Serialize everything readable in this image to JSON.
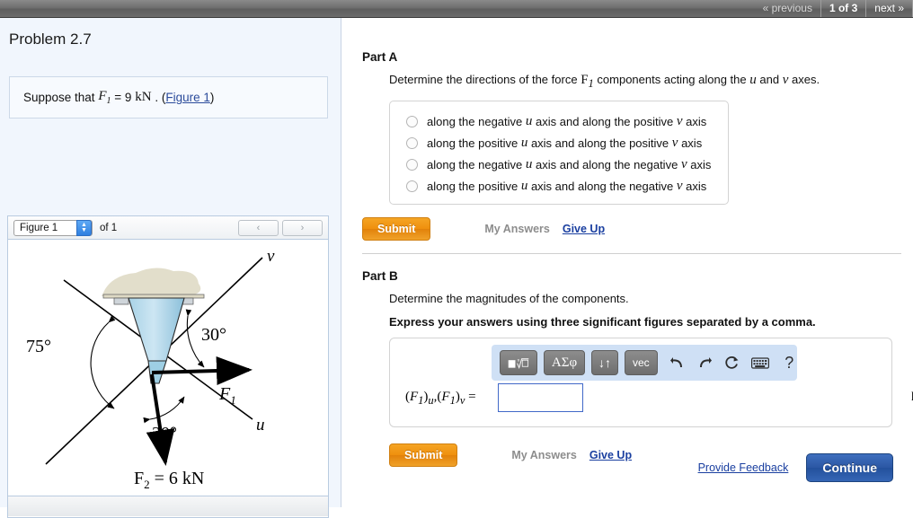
{
  "topnav": {
    "previous": "« previous",
    "counter": "1 of 3",
    "next": "next »"
  },
  "problem": {
    "title": "Problem 2.7",
    "statement_prefix": "Suppose that",
    "statement_var": "F",
    "statement_sub": "1",
    "statement_eq": "= 9",
    "statement_unit": "kN",
    "statement_dot": ".",
    "figure_link": "Figure 1",
    "paren_open": "(",
    "paren_close": ")"
  },
  "figure_widget": {
    "select_value": "Figure 1",
    "of_label": "of 1",
    "prev_arrow": "‹",
    "next_arrow": "›"
  },
  "figure": {
    "axis_v_label": "v",
    "axis_u_label": "u",
    "force1_label": "F",
    "force1_sub": "1",
    "force2_label": "F",
    "force2_sub": "2",
    "force2_value": "= 6 kN",
    "angle_75": "75°",
    "angle_30_upper": "30°",
    "angle_30_lower": "30°"
  },
  "partA": {
    "heading": "Part A",
    "question_pre": "Determine the directions of the force",
    "question_var": "F",
    "question_sub": "1",
    "question_mid": "components acting along the",
    "question_u": "u",
    "question_and": "and",
    "question_v": "v",
    "question_end": "axes.",
    "options": [
      {
        "pre": "along the negative",
        "u": "u",
        "mid": "axis and along the positive",
        "v": "v",
        "end": "axis"
      },
      {
        "pre": "along the positive",
        "u": "u",
        "mid": "axis and along the positive",
        "v": "v",
        "end": "axis"
      },
      {
        "pre": "along the negative",
        "u": "u",
        "mid": "axis and along the negative",
        "v": "v",
        "end": "axis"
      },
      {
        "pre": "along the positive",
        "u": "u",
        "mid": "axis and along the negative",
        "v": "v",
        "end": "axis"
      }
    ],
    "submit_label": "Submit",
    "my_answers_label": "My Answers",
    "give_up_label": "Give Up"
  },
  "partB": {
    "heading": "Part B",
    "question": "Determine the magnitudes of the components.",
    "instruction": "Express your answers using three significant figures separated by a comma.",
    "answer_label_open": "(",
    "answer_label_F": "F",
    "answer_label_sub": "1",
    "answer_label_close": ")",
    "answer_sub_u": "u",
    "answer_comma": ",",
    "answer_sub_v": "v",
    "answer_equals": "=",
    "answer_value": "",
    "answer_unit": "kN",
    "submit_label": "Submit",
    "my_answers_label": "My Answers",
    "give_up_label": "Give Up",
    "toolbar": {
      "template_label": "template-button",
      "greek_label": "ΑΣφ",
      "updown_label": "↓↑",
      "vec_label": "vec",
      "undo_label": "↰",
      "redo_label": "↱",
      "reset_label": "↻",
      "keyboard_label": "⌨",
      "help_label": "?"
    }
  },
  "footer": {
    "provide_feedback": "Provide Feedback",
    "continue_label": "Continue"
  },
  "colors": {
    "accent_orange": "#ef8f0d",
    "accent_blue": "#2b57a4",
    "link_blue": "#1a3fa0",
    "panel_bg": "#f1f6fd",
    "toolbar_bg": "#cfe0f5"
  }
}
